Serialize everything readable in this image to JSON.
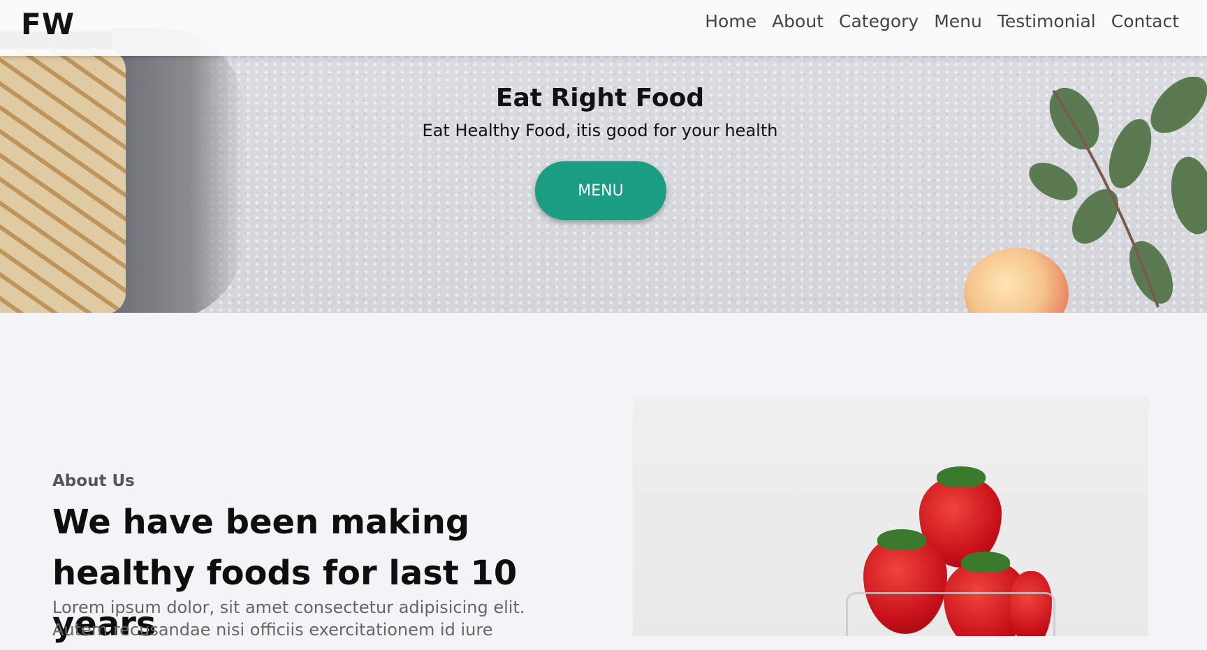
{
  "header": {
    "logo": "FW",
    "nav": [
      "Home",
      "About",
      "Category",
      "Menu",
      "Testimonial",
      "Contact"
    ]
  },
  "hero": {
    "title": "Eat Right Food",
    "subtitle": "Eat Healthy Food, itis good for your health",
    "button_label": "MENU"
  },
  "about": {
    "eyebrow": "About Us",
    "heading": "We have been making healthy foods for last 10 years",
    "text": "Lorem ipsum dolor, sit amet consectetur adipisicing elit. Autem recusandae nisi officiis exercitationem id iure"
  },
  "colors": {
    "accent": "#1a9d82",
    "page_bg": "#f4f4f6",
    "heading": "#0e0e0e"
  }
}
